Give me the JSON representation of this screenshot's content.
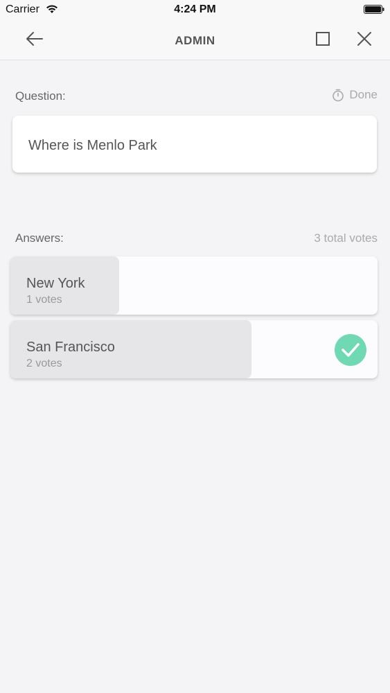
{
  "status_bar": {
    "carrier": "Carrier",
    "time": "4:24 PM"
  },
  "nav": {
    "title": "ADMIN",
    "icons": [
      "arrow-left-icon",
      "square-icon",
      "close-icon"
    ]
  },
  "question": {
    "label": "Question:",
    "done_label": "Done",
    "text": "Where is Menlo Park"
  },
  "answers": {
    "label": "Answers:",
    "total_votes": "3 total votes",
    "items": [
      {
        "name": "New York",
        "votes": "1 votes",
        "share": 0.33,
        "correct": false
      },
      {
        "name": "San Francisco",
        "votes": "2 votes",
        "share": 0.67,
        "correct": true
      }
    ]
  },
  "colors": {
    "accent_check": "#6fd9b4",
    "background": "#f4f3f6",
    "bar_fill": "#e6e5e8"
  }
}
